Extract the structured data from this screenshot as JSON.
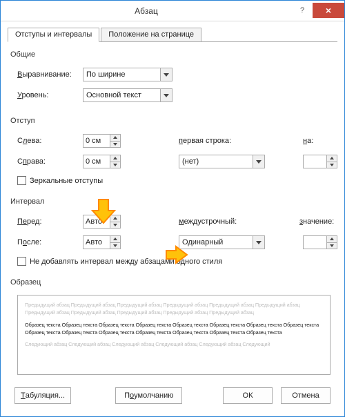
{
  "title": "Абзац",
  "tabs": {
    "t1": "Отступы и интервалы",
    "t2": "Положение на странице"
  },
  "general": {
    "title": "Общие",
    "align_label": "Выравнивание:",
    "align_value": "По ширине",
    "level_label": "Уровень:",
    "level_value": "Основной текст",
    "align_u": "В",
    "level_u": "У"
  },
  "indent": {
    "title": "Отступ",
    "left_label": "лева:",
    "left_u": "С",
    "left_value": "0 см",
    "right_label": "права:",
    "right_u": "С",
    "right_value": "0 см",
    "first_label": "ервая строка:",
    "first_u": "п",
    "first_value": "(нет)",
    "by_label": "а:",
    "by_u": "н",
    "mirror": "Зеркальные отступы"
  },
  "spacing": {
    "title": "Интервал",
    "before_label": "ред:",
    "before_u": "Пе",
    "before_value": "Авто",
    "after_label": "П",
    "after_label2": "сле:",
    "after_u": "о",
    "after_value": "Авто",
    "line_label": "еждустрочный:",
    "line_u": "м",
    "line_value": "Одинарный",
    "at_label": "начение:",
    "at_u": "з",
    "nospace": "Не добавлять интервал между абзацами одного стиля"
  },
  "sample": {
    "title": "Образец",
    "grey1": "Предыдущий абзац Предыдущий абзац Предыдущий абзац Предыдущий абзац Предыдущий абзац Предыдущий абзац Предыдущий абзац Предыдущий абзац Предыдущий абзац Предыдущий абзац Предыдущий абзац",
    "black": "Образец текста Образец текста Образец текста Образец текста Образец текста Образец текста Образец текста Образец текста Образец текста Образец текста Образец текста Образец текста Образец текста Образец текста Образец текста",
    "grey2": "Следующий абзац Следующий абзац Следующий абзац Следующий абзац Следующий абзац Следующий"
  },
  "buttons": {
    "tabs": "Табуляция...",
    "defaults": "По умолчанию",
    "ok": "ОК",
    "cancel": "Отмена",
    "tabs_u": "Т",
    "defaults_u": "о"
  }
}
